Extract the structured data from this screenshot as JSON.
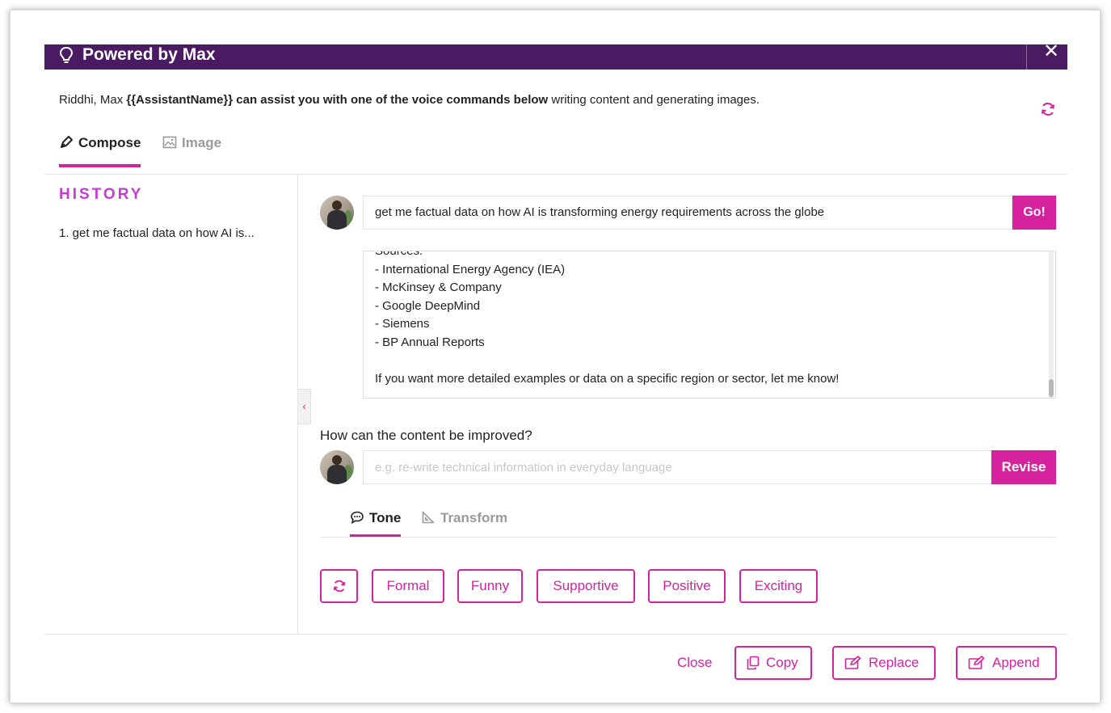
{
  "header": {
    "title": "Powered by Max",
    "close_label": "✕"
  },
  "intro": {
    "prefix": "Riddhi, Max ",
    "bold": "{{AssistantName}} can assist you with one of the voice commands below",
    "suffix": " writing content and generating images."
  },
  "main_tabs": [
    {
      "label": "Compose",
      "active": true
    },
    {
      "label": "Image",
      "active": false
    }
  ],
  "history": {
    "title": "HISTORY",
    "items": [
      "1. get me factual data on how AI is..."
    ]
  },
  "prompt": {
    "text": "get me factual data on how AI is transforming energy requirements across the globe",
    "go_label": "Go!"
  },
  "response": {
    "lines": [
      "Sources:",
      "- International Energy Agency (IEA)",
      "- McKinsey & Company",
      "- Google DeepMind",
      "- Siemens",
      "- BP Annual Reports",
      "",
      "If you want more detailed examples or data on a specific region or sector, let me know!"
    ]
  },
  "improve": {
    "label": "How can the content be improved?",
    "placeholder": "e.g. re-write technical information in everyday language",
    "revise_label": "Revise"
  },
  "tone_tabs": [
    {
      "label": "Tone",
      "active": true
    },
    {
      "label": "Transform",
      "active": false
    }
  ],
  "tone_chips": [
    "Formal",
    "Funny",
    "Supportive",
    "Positive",
    "Exciting"
  ],
  "footer": {
    "close_label": "Close",
    "copy_label": "Copy",
    "replace_label": "Replace",
    "append_label": "Append"
  },
  "colors": {
    "header_bg": "#4a1a63",
    "accent": "#d6229f",
    "history_title": "#c43bd6"
  }
}
